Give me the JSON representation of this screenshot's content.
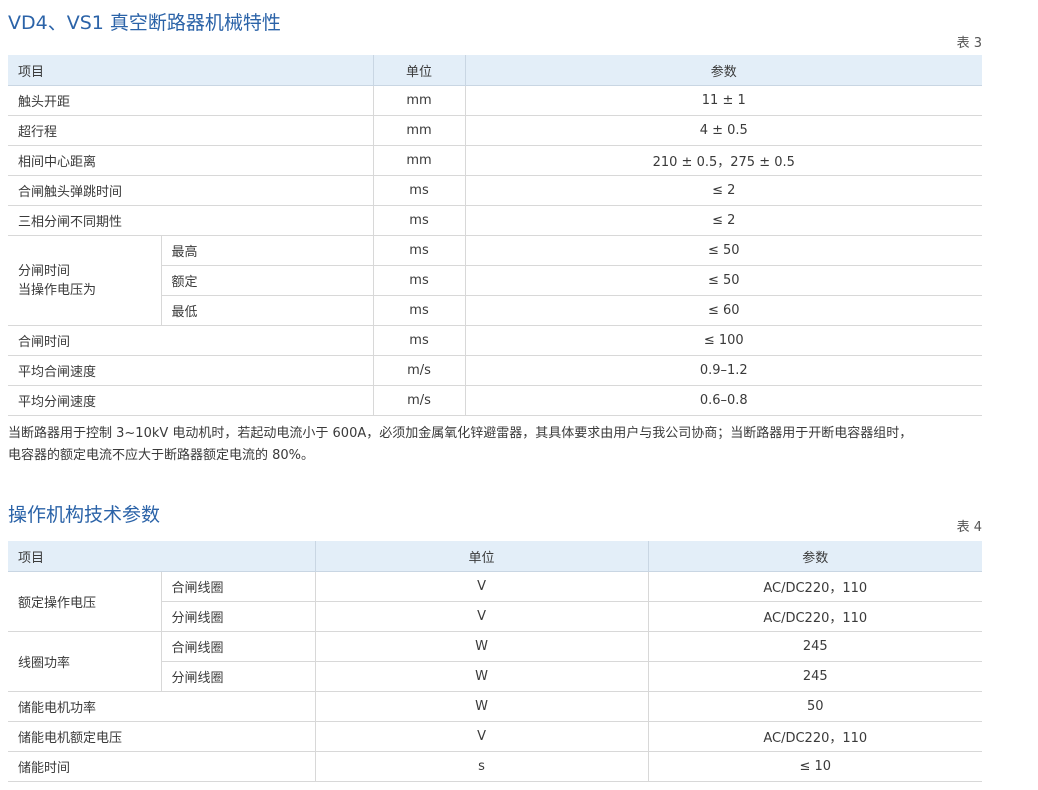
{
  "table3": {
    "title": "VD4、VS1 真空断路器机械特性",
    "number": "表 3",
    "headers": {
      "item": "项目",
      "unit": "单位",
      "param": "参数"
    },
    "rows": [
      {
        "item": "触头开距",
        "unit": "mm",
        "value": "11 ± 1"
      },
      {
        "item": "超行程",
        "unit": "mm",
        "value": "4 ± 0.5"
      },
      {
        "item": "相间中心距离",
        "unit": "mm",
        "value": "210 ± 0.5，275 ± 0.5"
      },
      {
        "item": "合闸触头弹跳时间",
        "unit": "ms",
        "value": "≤ 2"
      },
      {
        "item": "三相分闸不同期性",
        "unit": "ms",
        "value": "≤ 2"
      }
    ],
    "group": {
      "label_line1": "分闸时间",
      "label_line2": "当操作电压为",
      "subs": [
        {
          "sub": "最高",
          "unit": "ms",
          "value": "≤ 50"
        },
        {
          "sub": "额定",
          "unit": "ms",
          "value": "≤ 50"
        },
        {
          "sub": "最低",
          "unit": "ms",
          "value": "≤ 60"
        }
      ]
    },
    "rows2": [
      {
        "item": "合闸时间",
        "unit": "ms",
        "value": "≤ 100"
      },
      {
        "item": "平均合闸速度",
        "unit": "m/s",
        "value": "0.9–1.2"
      },
      {
        "item": "平均分闸速度",
        "unit": "m/s",
        "value": "0.6–0.8"
      }
    ]
  },
  "note": {
    "line1": "当断路器用于控制 3~10kV 电动机时，若起动电流小于 600A，必须加金属氧化锌避雷器，其具体要求由用户与我公司协商；当断路器用于开断电容器组时，",
    "line2": "电容器的额定电流不应大于断路器额定电流的 80%。"
  },
  "table4": {
    "title": "操作机构技术参数",
    "number": "表 4",
    "headers": {
      "item": "项目",
      "unit": "单位",
      "param": "参数"
    },
    "groups": [
      {
        "label": "额定操作电压",
        "subs": [
          {
            "sub": "合闸线圈",
            "unit": "V",
            "value": "AC/DC220，110"
          },
          {
            "sub": "分闸线圈",
            "unit": "V",
            "value": "AC/DC220，110"
          }
        ]
      },
      {
        "label": "线圈功率",
        "subs": [
          {
            "sub": "合闸线圈",
            "unit": "W",
            "value": "245"
          },
          {
            "sub": "分闸线圈",
            "unit": "W",
            "value": "245"
          }
        ]
      }
    ],
    "rows": [
      {
        "item": "储能电机功率",
        "unit": "W",
        "value": "50"
      },
      {
        "item": "储能电机额定电压",
        "unit": "V",
        "value": "AC/DC220，110"
      },
      {
        "item": "储能时间",
        "unit": "s",
        "value": "≤ 10"
      }
    ]
  }
}
